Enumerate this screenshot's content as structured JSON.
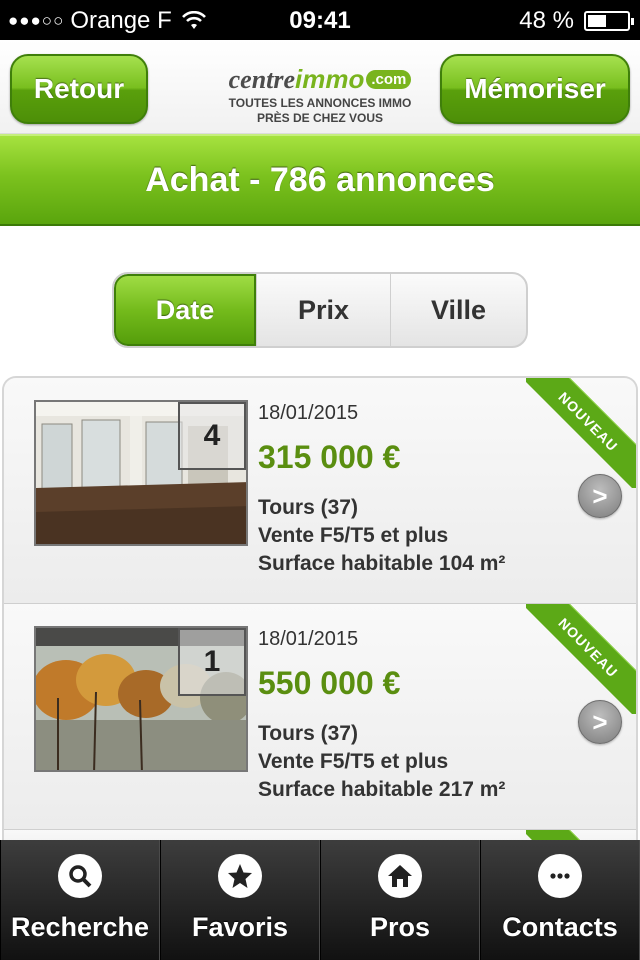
{
  "status": {
    "carrier": "Orange F",
    "time": "09:41",
    "battery": "48 %",
    "battery_level": 0.48
  },
  "header": {
    "back_label": "Retour",
    "save_label": "Mémoriser",
    "logo_brand_prefix": "centre",
    "logo_brand_main": "immo",
    "logo_brand_suffix": ".com",
    "logo_tagline_1": "TOUTES LES ANNONCES IMMO",
    "logo_tagline_2": "PRÈS DE CHEZ VOUS"
  },
  "title": "Achat - 786 annonces",
  "sort": {
    "options": [
      "Date",
      "Prix",
      "Ville"
    ],
    "selected": "Date"
  },
  "listings": [
    {
      "photo_count": "4",
      "date": "18/01/2015",
      "price": "315 000 €",
      "city": "Tours (37)",
      "type": "Vente F5/T5 et plus",
      "surface": "Surface habitable 104 m²",
      "badge": "NOUVEAU"
    },
    {
      "photo_count": "1",
      "date": "18/01/2015",
      "price": "550 000 €",
      "city": "Tours (37)",
      "type": "Vente F5/T5 et plus",
      "surface": "Surface habitable 217 m²",
      "badge": "NOUVEAU"
    }
  ],
  "tabs": [
    {
      "label": "Recherche",
      "icon": "search-icon"
    },
    {
      "label": "Favoris",
      "icon": "star-icon"
    },
    {
      "label": "Pros",
      "icon": "home-icon"
    },
    {
      "label": "Contacts",
      "icon": "more-icon"
    }
  ],
  "colors": {
    "accent_green": "#79bf1f",
    "price_green": "#5a8e10",
    "tabbar": "#1e1e1e"
  }
}
